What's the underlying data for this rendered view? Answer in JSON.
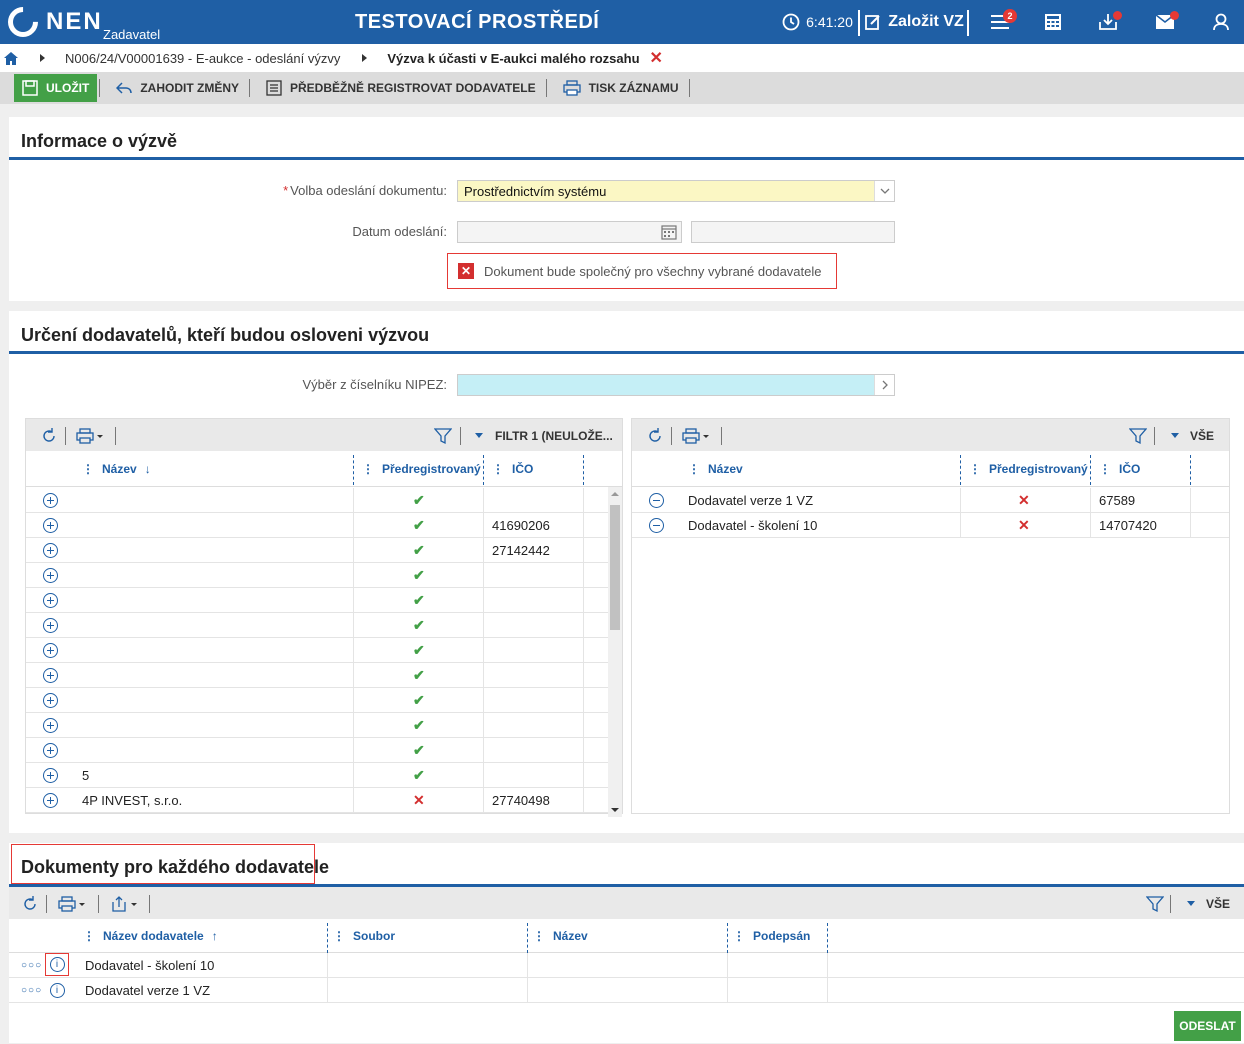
{
  "topbar": {
    "logo_text": "NEN",
    "logo_sub": "Zadavatel",
    "env_title": "TESTOVACÍ PROSTŘEDÍ",
    "clock_time": "6:41:20",
    "create_vz_label": "Založit VZ",
    "notif_count": "2",
    "accent_color": "#1f5fa5"
  },
  "breadcrumb": {
    "items": [
      "N006/24/V00001639 - E-aukce - odeslání výzvy",
      "Výzva k účasti v E-aukci malého rozsahu"
    ]
  },
  "toolbar": {
    "save_label": "ULOŽIT",
    "discard_label": "ZAHODIT ZMĚNY",
    "preregister_label": "PŘEDBĚŽNĚ REGISTROVAT DODAVATELE",
    "print_label": "TISK ZÁZNAMU"
  },
  "info_section": {
    "title": "Informace o výzvě",
    "send_mode_label": "Volba odeslání dokumentu:",
    "send_mode_required": "*",
    "send_mode_value": "Prostřednictvím systému",
    "date_label": "Datum odeslání:",
    "message": "Dokument bude společný pro všechny vybrané dodavatele"
  },
  "suppliers_section": {
    "title": "Určení dodavatelů, kteří budou osloveni výzvou",
    "nipez_label": "Výběr z číselníku NIPEZ:",
    "left_grid": {
      "filter_label": "FILTR 1 (NEULOŽE...",
      "columns": [
        "Název",
        "Předregistrovaný",
        "IČO"
      ],
      "rows": [
        {
          "name": "",
          "prereg": "yes",
          "ico": ""
        },
        {
          "name": "",
          "prereg": "yes",
          "ico": "41690206"
        },
        {
          "name": "",
          "prereg": "yes",
          "ico": "27142442"
        },
        {
          "name": "",
          "prereg": "yes",
          "ico": ""
        },
        {
          "name": "",
          "prereg": "yes",
          "ico": ""
        },
        {
          "name": "",
          "prereg": "yes",
          "ico": ""
        },
        {
          "name": "",
          "prereg": "yes",
          "ico": ""
        },
        {
          "name": "",
          "prereg": "yes",
          "ico": ""
        },
        {
          "name": "",
          "prereg": "yes",
          "ico": ""
        },
        {
          "name": "",
          "prereg": "yes",
          "ico": ""
        },
        {
          "name": "",
          "prereg": "yes",
          "ico": ""
        },
        {
          "name": "5",
          "prereg": "yes",
          "ico": ""
        },
        {
          "name": "4P INVEST, s.r.o.",
          "prereg": "no",
          "ico": "27740498"
        }
      ]
    },
    "right_grid": {
      "filter_label": "VŠE",
      "columns": [
        "Název",
        "Předregistrovaný",
        "IČO"
      ],
      "rows": [
        {
          "name": "Dodavatel verze 1 VZ",
          "prereg": "no",
          "ico": "67589"
        },
        {
          "name": "Dodavatel - školení 10",
          "prereg": "no",
          "ico": "14707420"
        }
      ]
    }
  },
  "documents_section": {
    "title": "Dokumenty pro každého dodavatele",
    "filter_label": "VŠE",
    "columns": [
      "Název dodavatele",
      "Soubor",
      "Název",
      "Podepsán"
    ],
    "rows": [
      {
        "supplier": "Dodavatel - školení 10"
      },
      {
        "supplier": "Dodavatel verze 1 VZ"
      }
    ],
    "send_label": "ODESLAT"
  }
}
